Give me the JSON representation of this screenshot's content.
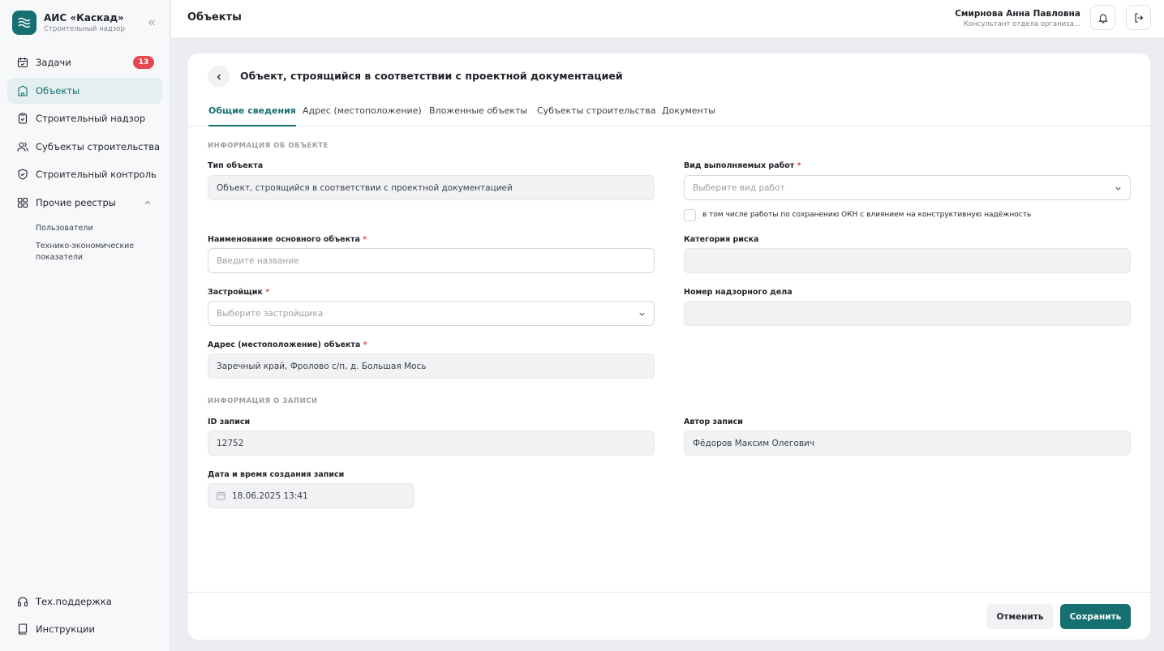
{
  "brand": {
    "title": "АИС «Каскад»",
    "subtitle": "Строительный надзор"
  },
  "nav": {
    "tasks": {
      "label": "Задачи",
      "badge": "13"
    },
    "objects": {
      "label": "Объекты"
    },
    "construction_supervision": {
      "label": "Строительный надзор"
    },
    "construction_subjects": {
      "label": "Субъекты строительства"
    },
    "construction_control": {
      "label": "Строительный контроль"
    },
    "other_registries": {
      "label": "Прочие реестры"
    },
    "sub_users": "Пользователи",
    "sub_tech_econ": "Технико-экономические показатели",
    "support": {
      "label": "Тех.поддержка"
    },
    "instructions": {
      "label": "Инструкции"
    }
  },
  "header": {
    "title": "Объекты",
    "user_name": "Смирнова Анна Павловна",
    "user_role": "Консультант отдела организа..."
  },
  "card": {
    "title": "Объект, строящийся в соответствии с проектной документацией",
    "tabs": [
      "Общие сведения",
      "Адрес (местоположение)",
      "Вложенные объекты",
      "Субъекты строительства",
      "Документы"
    ]
  },
  "form": {
    "section_object": "ИНФОРМАЦИЯ ОБ ОБЪЕКТЕ",
    "object_type": {
      "label": "Тип объекта",
      "value": "Объект, строящийся в соответствии с проектной документацией"
    },
    "work_type": {
      "label": "Вид выполняемых работ",
      "placeholder": "Выберите вид работ"
    },
    "okn_checkbox_label": "в том числе работы по сохранению ОКН с влиянием на конструктивную надёжность",
    "main_object_name": {
      "label": "Наименование основного объекта",
      "placeholder": "Введите название"
    },
    "risk_category": {
      "label": "Категория риска",
      "value": ""
    },
    "developer": {
      "label": "Застройщик",
      "placeholder": "Выберите застройщика"
    },
    "supervision_case_number": {
      "label": "Номер надзорного дела",
      "value": ""
    },
    "object_address": {
      "label": "Адрес (местоположение) объекта",
      "value": "Заречный край, Фролово с/п, д. Большая Мось"
    },
    "section_record": "ИНФОРМАЦИЯ О ЗАПИСИ",
    "record_id": {
      "label": "ID записи",
      "value": "12752"
    },
    "record_author": {
      "label": "Автор записи",
      "value": "Фёдоров Максим Олегович"
    },
    "created_at": {
      "label": "Дата и время создания записи",
      "value": "18.06.2025 13:41"
    },
    "required_mark": "*"
  },
  "actions": {
    "cancel": "Отменить",
    "save": "Сохранить"
  },
  "colors": {
    "accent": "#166f70",
    "badge": "#e5484d",
    "active_bg": "#e3eff0"
  }
}
